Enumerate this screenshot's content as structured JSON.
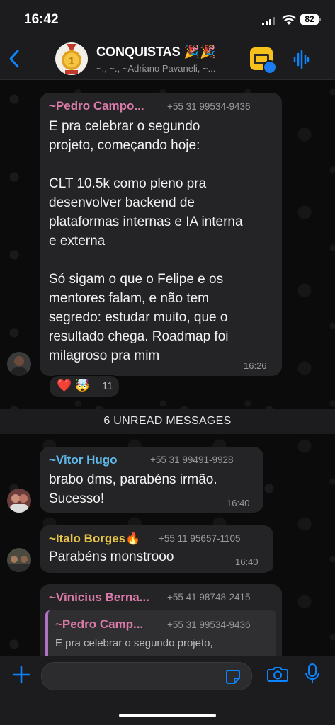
{
  "status_bar": {
    "time": "16:42",
    "battery": "82"
  },
  "header": {
    "title": "CONQUISTAS 🎉🎉",
    "subtitle": "~., ~., ~Adriano Pavaneli, ~..."
  },
  "messages": [
    {
      "sender": "~Pedro Campo...",
      "phone": "+55 31 99534-9436",
      "text": "E pra celebrar o segundo\nprojeto, começando hoje:\n\nCLT 10.5k como pleno pra\ndesenvolver backend de\nplataformas internas e IA interna\ne externa\n\nSó sigam o que o Felipe e os\nmentores falam, e não tem\nsegredo: estudar muito, que o\nresultado chega. Roadmap foi\nmilagroso pra mim",
      "time": "16:26",
      "reactions": {
        "emojis": "❤️ 🤯",
        "count": "11"
      },
      "sender_color": "#d97aa8"
    },
    {
      "sender": "~Vitor Hugo",
      "phone": "+55 31 99491-9928",
      "text": "brabo dms, parabéns irmão.\nSucesso!",
      "time": "16:40",
      "sender_color": "#5fb7e8"
    },
    {
      "sender": "~Italo Borges🔥",
      "phone": "+55 11 95657-1105",
      "text": "Parabéns monstrooo",
      "time": "16:40",
      "sender_color": "#e8c54a"
    },
    {
      "sender": "~Vinícius Berna...",
      "phone": "+55 41 98748-2415",
      "sender_color": "#d97aa8",
      "quote": {
        "sender": "~Pedro Camp...",
        "phone": "+55 31 99534-9436",
        "text": "E pra celebrar o segundo projeto,"
      }
    }
  ],
  "unread_label": "6 UNREAD MESSAGES",
  "input": {
    "placeholder": ""
  },
  "colors": {
    "bubble": "#242426",
    "accent": "#0a84ff",
    "background": "#0b0b0b"
  }
}
